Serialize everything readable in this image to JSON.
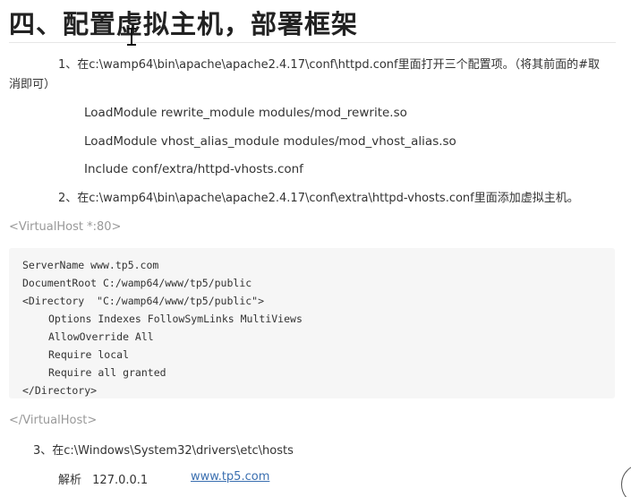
{
  "heading": "四、配置虚拟主机，部署框架",
  "step1": "1、在c:\\wamp64\\bin\\apache\\apache2.4.17\\conf\\httpd.conf里面打开三个配置项。（将其前面的#取消即可）",
  "directives": [
    "LoadModule rewrite_module modules/mod_rewrite.so",
    "LoadModule vhost_alias_module modules/mod_vhost_alias.so",
    "Include conf/extra/httpd-vhosts.conf"
  ],
  "step2": "2、在c:\\wamp64\\bin\\apache\\apache2.4.17\\conf\\extra\\httpd-vhosts.conf里面添加虚拟主机。",
  "vhost_open": "<VirtualHost *:80>",
  "code_lines": [
    "ServerName www.tp5.com",
    "DocumentRoot C:/wamp64/www/tp5/public",
    "<Directory  \"C:/wamp64/www/tp5/public\">",
    "Options Indexes FollowSymLinks MultiViews",
    "AllowOverride All",
    "Require local",
    "Require all granted",
    "</Directory>"
  ],
  "vhost_close": "</VirtualHost>",
  "step3": "3、在c:\\Windows\\System32\\drivers\\etc\\hosts",
  "hosts": {
    "label": "解析",
    "ip": "127.0.0.1",
    "domain": "www.tp5.com"
  },
  "colors": {
    "link": "#3a6fb0",
    "muted": "#999999",
    "code_bg": "#f6f6f6"
  }
}
